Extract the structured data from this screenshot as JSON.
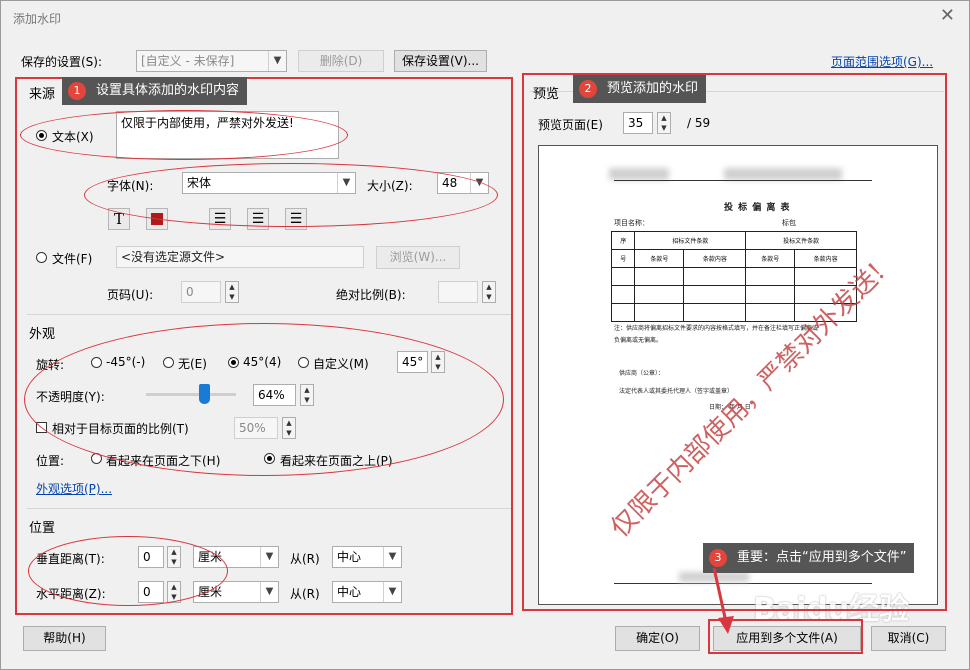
{
  "dialog": {
    "title": "添加水印"
  },
  "top": {
    "saved_label": "保存的设置(S):",
    "saved_value": "[自定义 - 未保存]",
    "delete": "删除(D)",
    "save": "保存设置(V)...",
    "page_range": "页面范围选项(G)..."
  },
  "source": {
    "title": "来源",
    "text_option": "文本(X)",
    "text_value": "仅限于内部使用，严禁对外发送!",
    "font_label": "字体(N):",
    "font_value": "宋体",
    "size_label": "大小(Z):",
    "size_value": "48",
    "file_option": "文件(F)",
    "file_value": "<没有选定源文件>",
    "browse": "浏览(W)...",
    "page_label": "页码(U):",
    "page_value": "0",
    "scale_label": "绝对比例(B):"
  },
  "appearance": {
    "title": "外观",
    "rotation_label": "旋转:",
    "rot_neg45": "-45°(-)",
    "rot_none": "无(E)",
    "rot_45": "45°(4)",
    "rot_custom": "自定义(M)",
    "rot_value": "45°",
    "opacity_label": "不透明度(Y):",
    "opacity_value": "64%",
    "opacity_level": 0.64,
    "relative_label": "相对于目标页面的比例(T)",
    "relative_value": "50%",
    "position_label": "位置:",
    "pos_below": "看起来在页面之下(H)",
    "pos_above": "看起来在页面之上(P)",
    "options_link": "外观选项(P)..."
  },
  "position": {
    "title": "位置",
    "vertical_label": "垂直距离(T):",
    "vertical_value": "0",
    "vertical_unit": "厘米",
    "from_label": "从(R)",
    "vertical_from": "中心",
    "horizontal_label": "水平距离(Z):",
    "horizontal_value": "0",
    "horizontal_unit": "厘米",
    "horizontal_from": "中心"
  },
  "preview": {
    "title": "预览",
    "page_label": "预览页面(E)",
    "page_value": "35",
    "page_total": "/ 59",
    "watermark_text": "仅限于内部使用，严禁对外发送!",
    "doc": {
      "title": "投 标 偏 离 表",
      "project": "项目名称：",
      "lot": "标包",
      "col_seq": "序",
      "col_seq2": "号",
      "group1": "招标文件条款",
      "group2": "投标文件条款",
      "clause_no": "条款号",
      "clause_content": "条款内容",
      "note": "注：供应商将偏离招标文件要求的内容按格式填写，并在备注栏填写正偏离或",
      "note2": "负偏离或无偏离。",
      "supplier": "供应商（公章）：",
      "rep": "法定代表人或其委托代理人（签字或盖章）",
      "date": "日期：    年    月    日"
    }
  },
  "annotations": {
    "tag1": "设置具体添加的水印内容",
    "tag2": "预览添加的水印",
    "tag3": "重要：点击“应用到多个文件”",
    "n1": "1",
    "n2": "2",
    "n3": "3",
    "colors": {
      "red": "#d9363e",
      "tag_bg": "#555555",
      "badge": "#e2453c"
    }
  },
  "bottom": {
    "help": "帮助(H)",
    "ok": "确定(O)",
    "apply_multi": "应用到多个文件(A)",
    "cancel": "取消(C)"
  },
  "watermark_brand": "Baidu经验"
}
